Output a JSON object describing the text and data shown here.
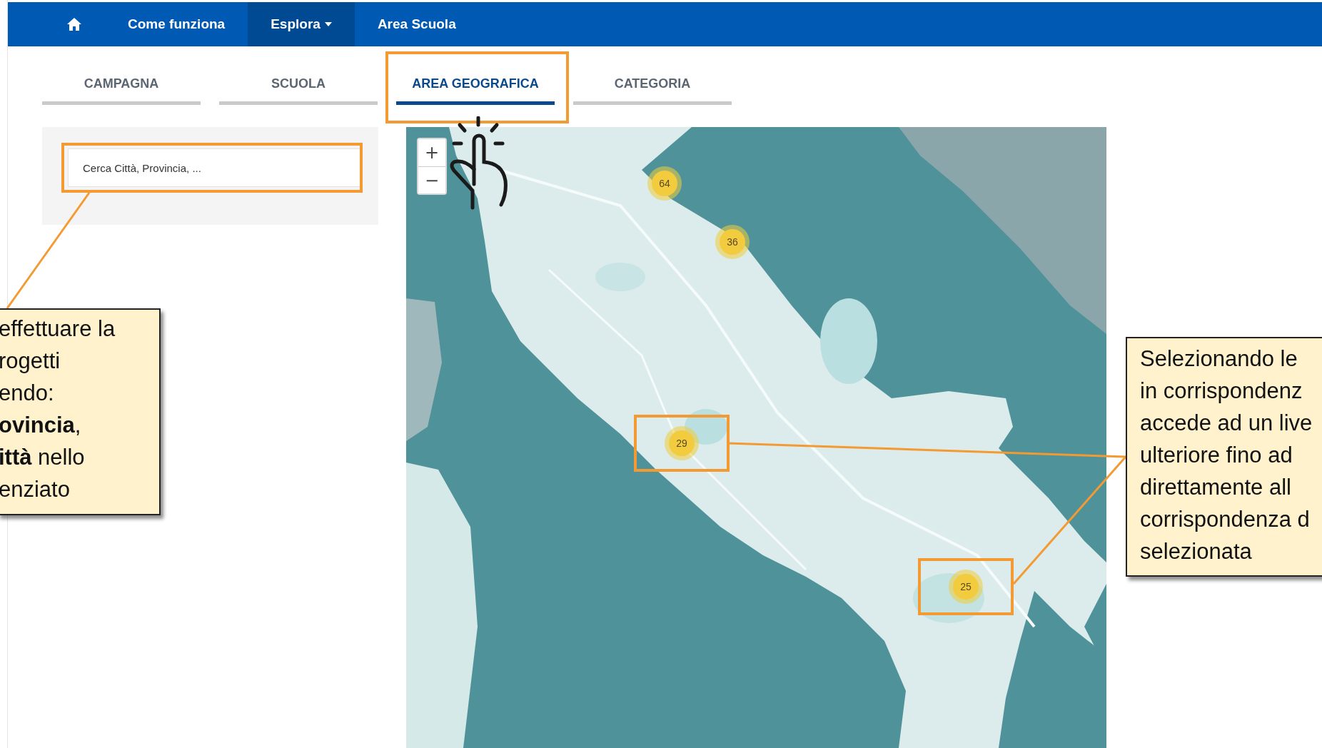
{
  "nav": {
    "items": [
      {
        "kind": "home",
        "selected": false,
        "dropdown": false
      },
      {
        "kind": "link",
        "label": "Come funziona",
        "selected": false,
        "dropdown": false
      },
      {
        "kind": "link",
        "label": "Esplora",
        "selected": true,
        "dropdown": true
      },
      {
        "kind": "link",
        "label": "Area Scuola",
        "selected": false,
        "dropdown": false
      }
    ]
  },
  "tabs": [
    {
      "label": "CAMPAGNA",
      "selected": false,
      "highlighted": false
    },
    {
      "label": "SCUOLA",
      "selected": false,
      "highlighted": false
    },
    {
      "label": "AREA GEOGRAFICA",
      "selected": true,
      "highlighted": true
    },
    {
      "label": "CATEGORIA",
      "selected": false,
      "highlighted": false
    }
  ],
  "search": {
    "placeholder": "Cerca Città, Provincia, ...",
    "highlighted": true
  },
  "map": {
    "zoom_in": "+",
    "zoom_out": "−",
    "clusters": [
      {
        "count": "64",
        "highlighted": false
      },
      {
        "count": "36",
        "highlighted": false
      },
      {
        "count": "29",
        "highlighted": true
      },
      {
        "count": "25",
        "highlighted": true
      }
    ]
  },
  "callouts": [
    {
      "text": "effettuare la\nrogetti\nendo:\n**ovincia**,\n**ittà** nello\nenziato"
    },
    {
      "text": "Selezionando le\nin corrispondenz\naccede ad un live\nulteriore fino ad\ndirettamente all\ncorrispondenza d\nselezionata"
    }
  ]
}
